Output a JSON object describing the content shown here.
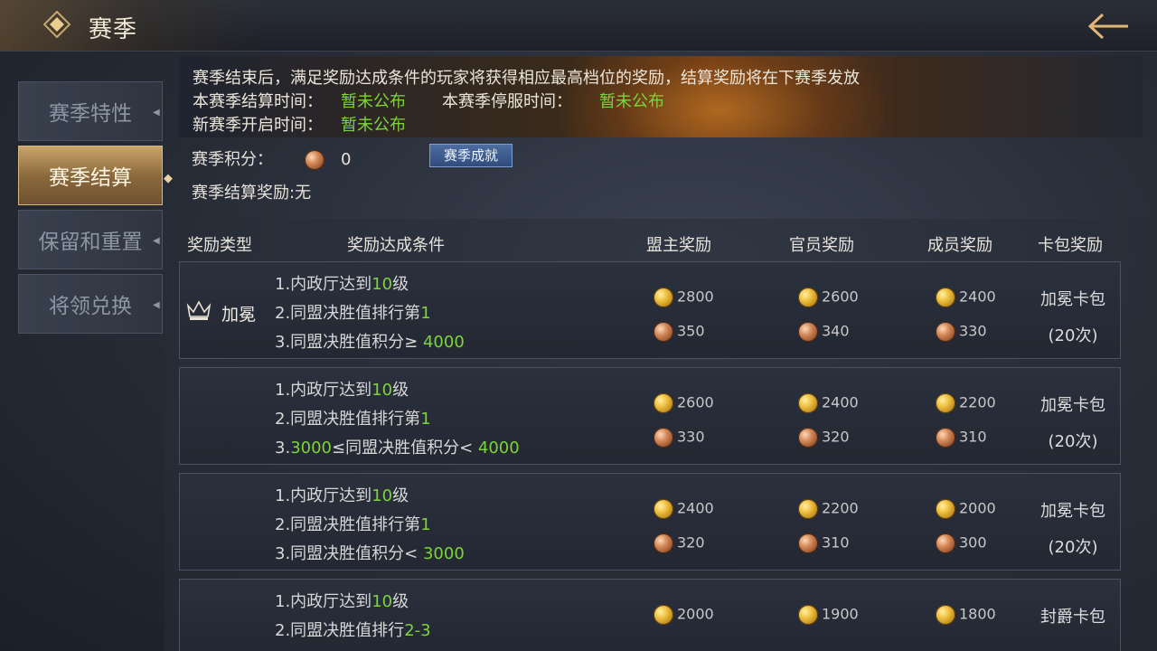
{
  "header": {
    "title": "赛季"
  },
  "sidebar": {
    "items": [
      {
        "label": "赛季特性",
        "active": false
      },
      {
        "label": "赛季结算",
        "active": true
      },
      {
        "label": "保留和重置",
        "active": false
      },
      {
        "label": "将领兑换",
        "active": false
      }
    ]
  },
  "info": {
    "notice": "赛季结束后，满足奖励达成条件的玩家将获得相应最高档位的奖励，结算奖励将在下赛季发放",
    "settle_time_label": "本赛季结算时间：",
    "settle_time_value": "暂未公布",
    "stop_time_label": "本赛季停服时间：",
    "stop_time_value": "暂未公布",
    "new_season_label": "新赛季开启时间：",
    "new_season_value": "暂未公布",
    "score_label": "赛季积分：",
    "score_value": "0",
    "achieve_button": "赛季成就",
    "reward_label": "赛季结算奖励:无"
  },
  "table": {
    "headers": {
      "type": "奖励类型",
      "condition": "奖励达成条件",
      "leader": "盟主奖励",
      "officer": "官员奖励",
      "member": "成员奖励",
      "pack": "卡包奖励"
    },
    "rows": [
      {
        "type": "加冕",
        "cond1_a": "1.内政厅达到",
        "cond1_b": "10",
        "cond1_c": "级",
        "cond2_a": "2.同盟决胜值排行第",
        "cond2_b": "1",
        "cond3_a": "3.同盟决胜值积分≥ ",
        "cond3_b": "4000",
        "cond3_c": "",
        "leader_gold": "2800",
        "leader_copper": "350",
        "officer_gold": "2600",
        "officer_copper": "340",
        "member_gold": "2400",
        "member_copper": "330",
        "pack": "加冕卡包",
        "pack_count": "(20次)"
      },
      {
        "type": "",
        "cond1_a": "1.内政厅达到",
        "cond1_b": "10",
        "cond1_c": "级",
        "cond2_a": "2.同盟决胜值排行第",
        "cond2_b": "1",
        "cond3_a": "3.",
        "cond3_b": "3000",
        "cond3_c": "≤同盟决胜值积分< ",
        "cond3_d": "4000",
        "leader_gold": "2600",
        "leader_copper": "330",
        "officer_gold": "2400",
        "officer_copper": "320",
        "member_gold": "2200",
        "member_copper": "310",
        "pack": "加冕卡包",
        "pack_count": "(20次)"
      },
      {
        "type": "",
        "cond1_a": "1.内政厅达到",
        "cond1_b": "10",
        "cond1_c": "级",
        "cond2_a": "2.同盟决胜值排行第",
        "cond2_b": "1",
        "cond3_a": "3.同盟决胜值积分< ",
        "cond3_b": "3000",
        "cond3_c": "",
        "leader_gold": "2400",
        "leader_copper": "320",
        "officer_gold": "2200",
        "officer_copper": "310",
        "member_gold": "2000",
        "member_copper": "300",
        "pack": "加冕卡包",
        "pack_count": "(20次)"
      },
      {
        "type": "",
        "cond1_a": "1.内政厅达到",
        "cond1_b": "10",
        "cond1_c": "级",
        "cond2_a": "2.同盟决胜值排行",
        "cond2_b": "2-3",
        "leader_gold": "2000",
        "officer_gold": "1900",
        "member_gold": "1800",
        "pack": "封爵卡包"
      }
    ]
  },
  "colors": {
    "accent_green": "#7dd43a",
    "active_tab": "#b8945c"
  }
}
